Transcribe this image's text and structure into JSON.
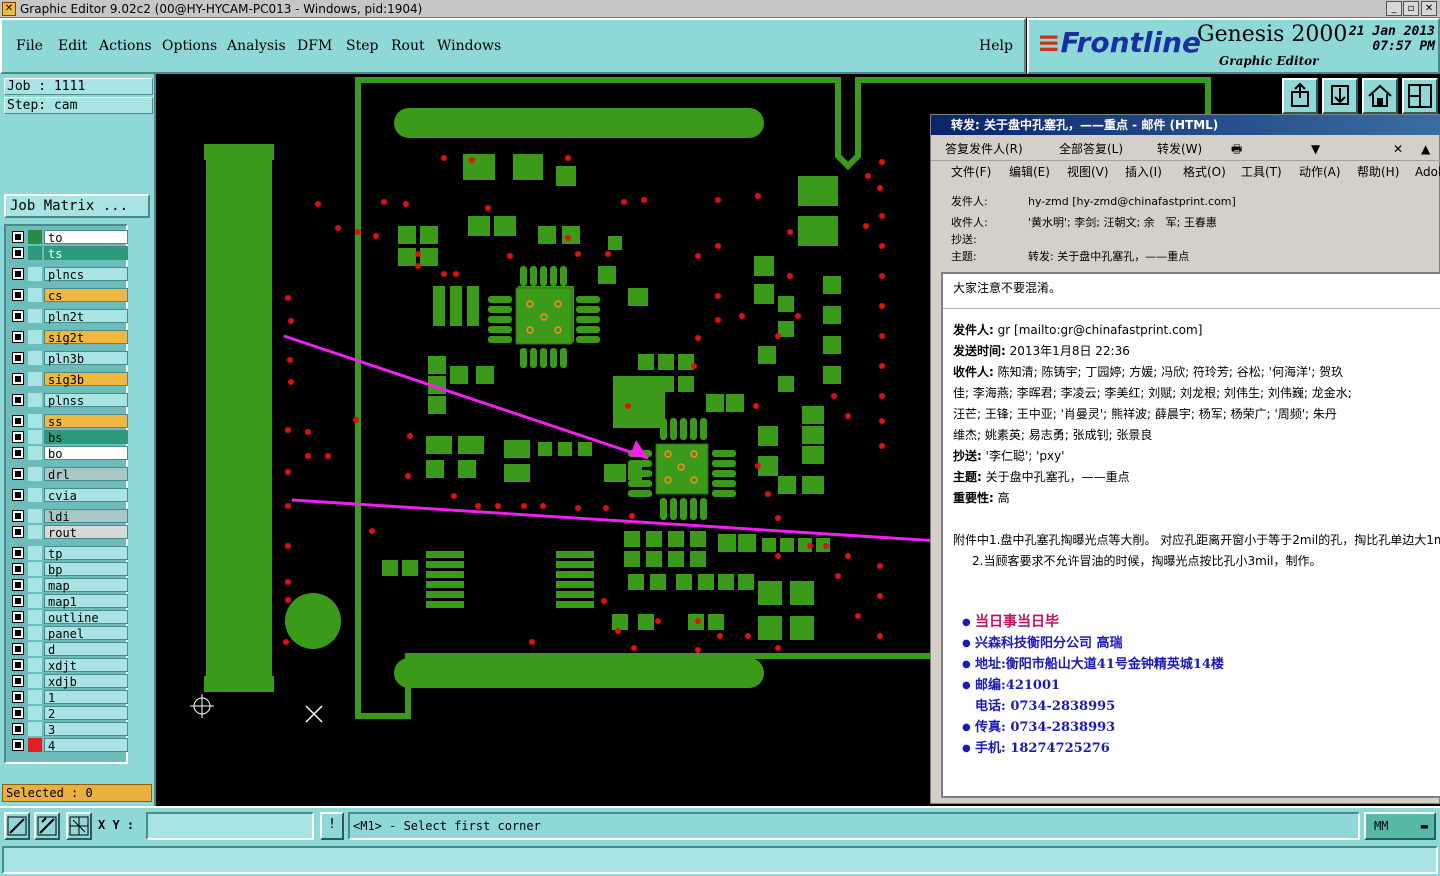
{
  "window": {
    "title": "Graphic Editor 9.02c2 (00@HY-HYCAM-PC013 - Windows, pid:1904)"
  },
  "menu": [
    "File",
    "Edit",
    "Actions",
    "Options",
    "Analysis",
    "DFM",
    "Step",
    "Rout",
    "Windows"
  ],
  "help_label": "Help",
  "brand": {
    "logo": "Frontline",
    "product": "Genesis 2000",
    "subtitle": "Graphic Editor",
    "date": "21 Jan 2013",
    "time": "07:57 PM"
  },
  "job": {
    "job_label": "Job  : 1111",
    "step_label": "Step: cam",
    "matrix_button": "Job Matrix ..."
  },
  "layers": [
    {
      "name": "to",
      "color": "#ffffff",
      "icon_color": "#2a8a4a"
    },
    {
      "name": "ts",
      "color": "#2a9a7a",
      "icon_color": "#2a9a7a",
      "active": true
    },
    {
      "name": "plncs",
      "color": "#a8e4e4",
      "icon_color": "#a8e4e4"
    },
    {
      "name": "cs",
      "color": "#f0b840",
      "icon_color": "#a8e4e4"
    },
    {
      "name": "pln2t",
      "color": "#a8e4e4",
      "icon_color": "#a8e4e4"
    },
    {
      "name": "sig2t",
      "color": "#f0b840",
      "icon_color": "#a8e4e4"
    },
    {
      "name": "pln3b",
      "color": "#a8e4e4",
      "icon_color": "#a8e4e4"
    },
    {
      "name": "sig3b",
      "color": "#f0b840",
      "icon_color": "#a8e4e4"
    },
    {
      "name": "plnss",
      "color": "#a8e4e4",
      "icon_color": "#a8e4e4"
    },
    {
      "name": "ss",
      "color": "#f0b840",
      "icon_color": "#a8e4e4"
    },
    {
      "name": "bs",
      "color": "#2a9a7a",
      "icon_color": "#a8e4e4"
    },
    {
      "name": "bo",
      "color": "#ffffff",
      "icon_color": "#a8e4e4"
    },
    {
      "name": "drl",
      "color": "#a8c8c8",
      "icon_color": "#a8e4e4"
    },
    {
      "name": "cvia",
      "color": "#a8e4e4",
      "icon_color": "#a8e4e4"
    },
    {
      "name": "ldi",
      "color": "#a8c8c8",
      "icon_color": "#a8e4e4"
    },
    {
      "name": "rout",
      "color": "#d8d8d8",
      "icon_color": "#a8e4e4"
    },
    {
      "name": "tp",
      "color": "#a8e4e4",
      "icon_color": "#a8e4e4"
    },
    {
      "name": "bp",
      "color": "#a8e4e4",
      "icon_color": "#a8e4e4"
    },
    {
      "name": "map",
      "color": "#a8e4e4",
      "icon_color": "#a8e4e4"
    },
    {
      "name": "map1",
      "color": "#a8e4e4",
      "icon_color": "#a8e4e4"
    },
    {
      "name": "outline",
      "color": "#a8e4e4",
      "icon_color": "#a8e4e4"
    },
    {
      "name": "panel",
      "color": "#a8e4e4",
      "icon_color": "#a8e4e4"
    },
    {
      "name": "d",
      "color": "#a8e4e4",
      "icon_color": "#a8e4e4"
    },
    {
      "name": "xdjt",
      "color": "#a8e4e4",
      "icon_color": "#a8e4e4"
    },
    {
      "name": "xdjb",
      "color": "#a8e4e4",
      "icon_color": "#a8e4e4"
    },
    {
      "name": "1",
      "color": "#a8e4e4",
      "icon_color": "#a8e4e4"
    },
    {
      "name": "2",
      "color": "#a8e4e4",
      "icon_color": "#a8e4e4"
    },
    {
      "name": "3",
      "color": "#a8e4e4",
      "icon_color": "#a8e4e4"
    },
    {
      "name": "4",
      "color": "#a8e4e4",
      "icon_color": "#e02020"
    }
  ],
  "selected_label": "Selected : 0",
  "status": {
    "xy_label": "X Y :",
    "xy_value": "",
    "info_btn": "!",
    "prompt": "<M1> - Select first corner",
    "units": "MM"
  },
  "email": {
    "title": "转发: 关于盘中孔塞孔，——重点 - 邮件 (HTML)",
    "toolbar": [
      "答复发件人(R)",
      "全部答复(L)",
      "转发(W)"
    ],
    "menu": [
      "文件(F)",
      "编辑(E)",
      "视图(V)",
      "插入(I)",
      "格式(O)",
      "工具(T)",
      "动作(A)",
      "帮助(H)",
      "Adob"
    ],
    "header": {
      "from_label": "发件人:",
      "from": "hy-zmd [hy-zmd@chinafastprint.com]",
      "to_label": "收件人:",
      "to": "'黄水明'; 李剑; 汪朝文; 余　军; 王春惠",
      "cc_label": "抄送:",
      "cc": "",
      "subject_label": "主题:",
      "subject": "转发: 关于盘中孔塞孔，——重点"
    },
    "body": {
      "intro": "大家注意不要混淆。",
      "fwd_from_label": "发件人:",
      "fwd_from": "gr [mailto:gr@chinafastprint.com]",
      "fwd_sent_label": "发送时间:",
      "fwd_sent": "2013年1月8日 22:36",
      "fwd_to_label": "收件人:",
      "fwd_to_1": "陈知清; 陈铸宇; 丁园婷; 方媛; 冯欣; 符玲芳; 谷松; '何海洋'; 贺玖",
      "fwd_to_2": "佳; 李海燕; 李晖君; 李凌云; 李美红; 刘赋; 刘龙根; 刘伟生; 刘伟巍; 龙金水;",
      "fwd_to_3": "汪芒; 王锋; 王中亚; '肖曼灵'; 熊祥波; 薛晨宇; 杨军; 杨荣广; '周频'; 朱丹",
      "fwd_to_4": "维杰; 姚素英; 易志勇; 张成钊; 张景良",
      "fwd_cc_label": "抄送:",
      "fwd_cc": "'李仁聪'; 'pxy'",
      "fwd_subject_label": "主题:",
      "fwd_subject": "关于盘中孔塞孔，——重点",
      "importance_label": "重要性:",
      "importance": "高",
      "note1": "附件中1.盘中孔塞孔掏曝光点等大削。   对应孔距离开窗小于等于2mil的孔，掏比孔单边大1m",
      "note2": "2.当顾客要求不允许冒油的时候，掏曝光点按比孔小3mil，制作。"
    },
    "signature": {
      "motto": "当日事当日毕",
      "company": "兴森科技衡阳分公司  高瑞",
      "address": "地址:衡阳市船山大道41号金钟精英城14楼",
      "postcode": "邮编:421001",
      "phone": "电话:  0734-2838995",
      "fax": "传真:  0734-2838993",
      "mobile": "手机:  18274725276"
    }
  }
}
